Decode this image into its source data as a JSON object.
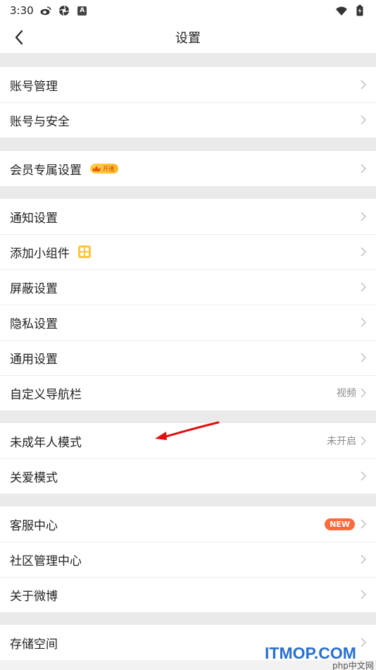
{
  "status_bar": {
    "time": "3:30",
    "a_glyph": "A",
    "icons": [
      "weibo-icon",
      "app-icon",
      "a-icon",
      "wifi-icon",
      "battery-icon"
    ]
  },
  "header": {
    "title": "设置",
    "back_icon": "chevron-left-icon"
  },
  "sections": [
    {
      "items": [
        {
          "label": "账号管理"
        },
        {
          "label": "账号与安全"
        }
      ]
    },
    {
      "items": [
        {
          "label": "会员专属设置",
          "badge": "开通"
        }
      ]
    },
    {
      "items": [
        {
          "label": "通知设置"
        },
        {
          "label": "添加小组件"
        },
        {
          "label": "屏蔽设置"
        },
        {
          "label": "隐私设置"
        },
        {
          "label": "通用设置"
        },
        {
          "label": "自定义导航栏",
          "value": "视频"
        }
      ]
    },
    {
      "items": [
        {
          "label": "未成年人模式",
          "value": "未开启"
        },
        {
          "label": "关爱模式"
        }
      ]
    },
    {
      "items": [
        {
          "label": "客服中心",
          "badge": "NEW"
        },
        {
          "label": "社区管理中心"
        },
        {
          "label": "关于微博"
        }
      ]
    },
    {
      "items": [
        {
          "label": "存储空间"
        }
      ]
    }
  ],
  "watermark": {
    "text": "ITMOP.COM",
    "sub": "php中文网"
  },
  "colors": {
    "background": "#f2f2f2",
    "new_badge": "#ff6a3d",
    "annotation_arrow": "#e01010",
    "watermark": "#2a6fd0"
  }
}
